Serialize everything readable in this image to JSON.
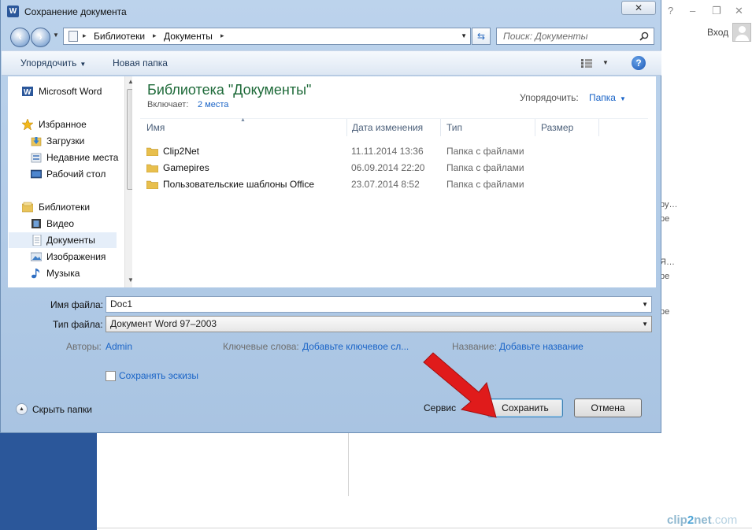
{
  "background": {
    "login_label": "Вход",
    "window_controls": [
      "?",
      "–",
      "❐",
      "✕"
    ],
    "peek_lines": [
      "ру…",
      "ре",
      "Я…",
      "ре",
      "ре"
    ],
    "watermark": {
      "part1": "clip",
      "part2": "2",
      "part3": "net",
      "part4": ".com"
    }
  },
  "dialog": {
    "title": "Сохранение документа",
    "app_icon_letter": "W",
    "close_label": "✕",
    "address": {
      "segments": [
        "Библиотеки",
        "Документы"
      ],
      "sep": "▸"
    },
    "search": {
      "placeholder": "Поиск: Документы"
    },
    "toolbar": {
      "organize": "Упорядочить",
      "new_folder": "Новая папка",
      "help": "?"
    },
    "nav": {
      "items": [
        {
          "label": "Microsoft Word",
          "icon": "word-icon",
          "kind": "group"
        },
        {
          "label": "Избранное",
          "icon": "star-icon",
          "kind": "group"
        },
        {
          "label": "Загрузки",
          "icon": "downloads-icon",
          "kind": "child"
        },
        {
          "label": "Недавние места",
          "icon": "recent-places-icon",
          "kind": "child"
        },
        {
          "label": "Рабочий стол",
          "icon": "desktop-icon",
          "kind": "child"
        },
        {
          "label": "Библиотеки",
          "icon": "libraries-icon",
          "kind": "group"
        },
        {
          "label": "Видео",
          "icon": "video-icon",
          "kind": "child"
        },
        {
          "label": "Документы",
          "icon": "documents-icon",
          "kind": "selected"
        },
        {
          "label": "Изображения",
          "icon": "pictures-icon",
          "kind": "child"
        },
        {
          "label": "Музыка",
          "icon": "music-icon",
          "kind": "child"
        }
      ]
    },
    "library": {
      "title": "Библиотека \"Документы\"",
      "includes_label": "Включает:",
      "includes_link": "2 места",
      "arrange_label": "Упорядочить:",
      "arrange_value": "Папка"
    },
    "columns": [
      "Имя",
      "Дата изменения",
      "Тип",
      "Размер"
    ],
    "files": [
      {
        "name": "Clip2Net",
        "date": "11.11.2014 13:36",
        "type": "Папка с файлами"
      },
      {
        "name": "Gamepires",
        "date": "06.09.2014 22:20",
        "type": "Папка с файлами"
      },
      {
        "name": "Пользовательские шаблоны Office",
        "date": "23.07.2014 8:52",
        "type": "Папка с файлами"
      }
    ],
    "form": {
      "filename_label": "Имя файла:",
      "filename_value": "Doc1",
      "filetype_label": "Тип файла:",
      "filetype_value": "Документ Word 97–2003",
      "authors_label": "Авторы:",
      "authors_value": "Admin",
      "keywords_label": "Ключевые слова:",
      "keywords_value": "Добавьте ключевое сл...",
      "title_label": "Название:",
      "title_value": "Добавьте название",
      "thumbnails_label": "Сохранять эскизы"
    },
    "footer": {
      "hide_folders": "Скрыть папки",
      "service": "Сервис",
      "save": "Сохранить",
      "cancel": "Отмена"
    }
  },
  "colors": {
    "word_blue": "#2b579a",
    "library_title": "#1e6a39",
    "link_blue": "#1a64c7",
    "annotation_arrow": "#e01b1b"
  }
}
